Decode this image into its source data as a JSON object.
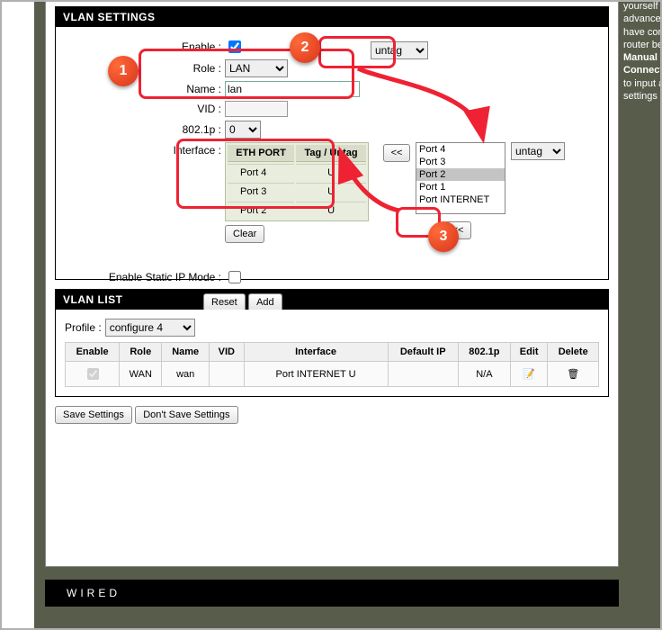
{
  "settings": {
    "title": "VLAN SETTINGS",
    "enable_label": "Enable :",
    "enable_checked": true,
    "role_label": "Role :",
    "role_value": "LAN",
    "name_label": "Name :",
    "name_value": "lan",
    "vid_label": "VID :",
    "vid_value": "",
    "p8021_label": "802.1p :",
    "p8021_value": "0",
    "interface_label": "Interface :",
    "eth_header_port": "ETH PORT",
    "eth_header_tag": "Tag / Untag",
    "eth_rows": [
      {
        "port": "Port 4",
        "tag": "U"
      },
      {
        "port": "Port 3",
        "tag": "U"
      },
      {
        "port": "Port 2",
        "tag": "U"
      }
    ],
    "clear_btn": "Clear",
    "enable_static_label": "Enable Static IP Mode :",
    "enable_static_checked": false,
    "reset_btn": "Reset",
    "add_btn": "Add",
    "move_left": "<<",
    "move_left2": "<<",
    "tag_select_top": "untag",
    "tag_select_side": "untag",
    "ports_list": [
      "Port 4",
      "Port 3",
      "Port 2",
      "Port 1",
      "Port INTERNET"
    ],
    "ports_selected_index": 2
  },
  "vlan_list": {
    "title": "VLAN LIST",
    "profile_label": "Profile :",
    "profile_value": "configure 4",
    "columns": [
      "Enable",
      "Role",
      "Name",
      "VID",
      "Interface",
      "Default IP",
      "802.1p",
      "Edit",
      "Delete"
    ],
    "rows": [
      {
        "enable": true,
        "role": "WAN",
        "name": "wan",
        "vid": "",
        "interface": "Port INTERNET U",
        "default_ip": "",
        "p8021": "N/A"
      }
    ]
  },
  "buttons": {
    "save": "Save Settings",
    "dont_save": "Don't Save Settings"
  },
  "footer": "WIRED",
  "side_help": {
    "l1": "yourself a",
    "l2": "advanced",
    "l3": "have confi",
    "l4": "router bef",
    "l5": "Manual I",
    "l6": "Connecti",
    "l7": "to input al",
    "l8": "settings m"
  },
  "callouts": {
    "c1": "1",
    "c2": "2",
    "c3": "3"
  }
}
